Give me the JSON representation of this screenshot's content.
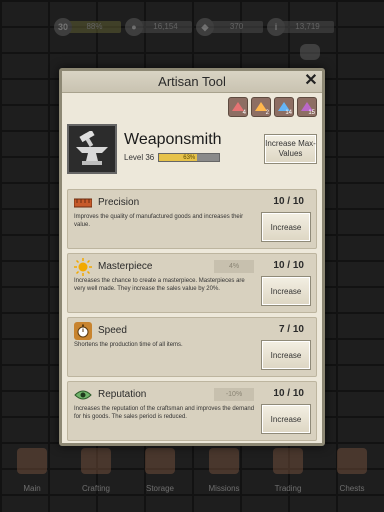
{
  "topbar": {
    "level": "30",
    "xp": "88%",
    "gold": "16,154",
    "gems": "370",
    "tokens": "13,719"
  },
  "modal": {
    "title": "Artisan Tool",
    "close": "✕",
    "gems": [
      {
        "count": "4",
        "color": "#e57373"
      },
      {
        "count": "2",
        "color": "#ffb74d"
      },
      {
        "count": "14",
        "color": "#64b5f6"
      },
      {
        "count": "15",
        "color": "#ba68c8"
      }
    ],
    "tool": {
      "name": "Weaponsmith",
      "level_label": "Level 36",
      "progress_text": "63%",
      "progress": 0.63,
      "max_button": "Increase Max-Values"
    },
    "skills": [
      {
        "name": "Precision",
        "icon": "ruler-icon",
        "bonus": "",
        "level": "10 / 10",
        "desc": "Improves the quality of manufactured goods and increases their value.",
        "button": "Increase"
      },
      {
        "name": "Masterpiece",
        "icon": "sun-icon",
        "bonus": "4%",
        "level": "10 / 10",
        "desc": "Increases the chance to create a masterpiece. Masterpieces are very well made. They increase the sales value by 20%.",
        "button": "Increase"
      },
      {
        "name": "Speed",
        "icon": "stopwatch-icon",
        "bonus": "",
        "level": "7 / 10",
        "desc": "Shortens the production time of all items.",
        "button": "Increase"
      },
      {
        "name": "Reputation",
        "icon": "eye-icon",
        "bonus": "-10%",
        "level": "10 / 10",
        "desc": "Increases the reputation of the craftsman and improves the demand for his goods. The sales period is reduced.",
        "button": "Increase"
      }
    ]
  },
  "nav": [
    {
      "label": "Main"
    },
    {
      "label": "Crafting"
    },
    {
      "label": "Storage"
    },
    {
      "label": "Missions"
    },
    {
      "label": "Trading"
    },
    {
      "label": "Chests"
    }
  ]
}
